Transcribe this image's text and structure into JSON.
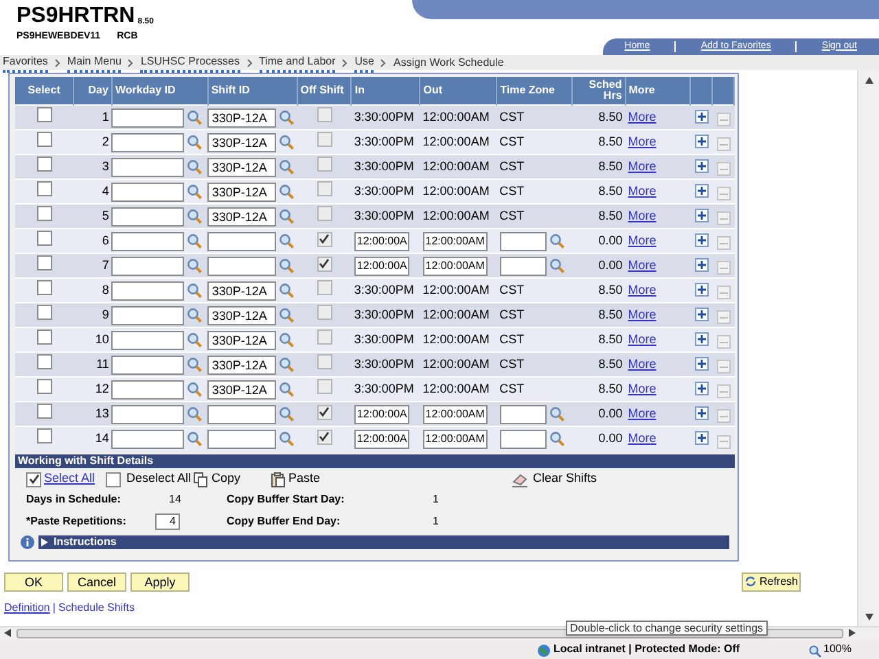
{
  "header": {
    "app": "PS9HRTRN",
    "version": "8.50",
    "database": "PS9HEWEBDEV11",
    "user": "RCB",
    "links": [
      "Home",
      "Add to Favorites",
      "Sign out"
    ]
  },
  "breadcrumbs": [
    {
      "label": "Favorites",
      "menu": true
    },
    {
      "label": "Main Menu",
      "menu": true
    },
    {
      "label": "LSUHSC Processes",
      "menu": true
    },
    {
      "label": "Time and Labor",
      "menu": true
    },
    {
      "label": "Use",
      "menu": true
    },
    {
      "label": "Assign Work Schedule",
      "menu": false
    }
  ],
  "table": {
    "columns": [
      "Select",
      "Day",
      "Workday ID",
      "Shift ID",
      "Off Shift",
      "In",
      "Out",
      "Time Zone",
      "Sched Hrs",
      "More"
    ],
    "rows": [
      {
        "day": "1",
        "kind": "shift",
        "selected": false,
        "shift_id": "330P-12A",
        "off_shift": false,
        "in": "3:30:00PM",
        "out": "12:00:00AM",
        "time_zone": "CST",
        "hrs": "8.50",
        "more": "More"
      },
      {
        "day": "2",
        "kind": "shift",
        "selected": false,
        "shift_id": "330P-12A",
        "off_shift": false,
        "in": "3:30:00PM",
        "out": "12:00:00AM",
        "time_zone": "CST",
        "hrs": "8.50",
        "more": "More"
      },
      {
        "day": "3",
        "kind": "shift",
        "selected": false,
        "shift_id": "330P-12A",
        "off_shift": false,
        "in": "3:30:00PM",
        "out": "12:00:00AM",
        "time_zone": "CST",
        "hrs": "8.50",
        "more": "More"
      },
      {
        "day": "4",
        "kind": "shift",
        "selected": false,
        "shift_id": "330P-12A",
        "off_shift": false,
        "in": "3:30:00PM",
        "out": "12:00:00AM",
        "time_zone": "CST",
        "hrs": "8.50",
        "more": "More"
      },
      {
        "day": "5",
        "kind": "shift",
        "selected": false,
        "shift_id": "330P-12A",
        "off_shift": false,
        "in": "3:30:00PM",
        "out": "12:00:00AM",
        "time_zone": "CST",
        "hrs": "8.50",
        "more": "More"
      },
      {
        "day": "6",
        "kind": "off",
        "selected": false,
        "off_shift": true,
        "in": "12:00:00A",
        "out": "12:00:00AM",
        "hrs": "0.00",
        "more": "More"
      },
      {
        "day": "7",
        "kind": "off",
        "selected": false,
        "off_shift": true,
        "in": "12:00:00A",
        "out": "12:00:00AM",
        "hrs": "0.00",
        "more": "More"
      },
      {
        "day": "8",
        "kind": "shift",
        "selected": false,
        "shift_id": "330P-12A",
        "off_shift": false,
        "in": "3:30:00PM",
        "out": "12:00:00AM",
        "time_zone": "CST",
        "hrs": "8.50",
        "more": "More"
      },
      {
        "day": "9",
        "kind": "shift",
        "selected": false,
        "shift_id": "330P-12A",
        "off_shift": false,
        "in": "3:30:00PM",
        "out": "12:00:00AM",
        "time_zone": "CST",
        "hrs": "8.50",
        "more": "More"
      },
      {
        "day": "10",
        "kind": "shift",
        "selected": false,
        "shift_id": "330P-12A",
        "off_shift": false,
        "in": "3:30:00PM",
        "out": "12:00:00AM",
        "time_zone": "CST",
        "hrs": "8.50",
        "more": "More"
      },
      {
        "day": "11",
        "kind": "shift",
        "selected": false,
        "shift_id": "330P-12A",
        "off_shift": false,
        "in": "3:30:00PM",
        "out": "12:00:00AM",
        "time_zone": "CST",
        "hrs": "8.50",
        "more": "More"
      },
      {
        "day": "12",
        "kind": "shift",
        "selected": false,
        "shift_id": "330P-12A",
        "off_shift": false,
        "in": "3:30:00PM",
        "out": "12:00:00AM",
        "time_zone": "CST",
        "hrs": "8.50",
        "more": "More"
      },
      {
        "day": "13",
        "kind": "off",
        "selected": false,
        "off_shift": true,
        "in": "12:00:00A",
        "out": "12:00:00AM",
        "hrs": "0.00",
        "more": "More"
      },
      {
        "day": "14",
        "kind": "off",
        "selected": false,
        "off_shift": true,
        "in": "12:00:00A",
        "out": "12:00:00AM",
        "hrs": "0.00",
        "more": "More"
      }
    ]
  },
  "shift_details": {
    "title": "Working with Shift Details",
    "select_all": {
      "label": "Select All",
      "checked": true
    },
    "deselect_all": {
      "label": "Deselect All",
      "checked": false
    },
    "copy": "Copy",
    "paste": "Paste",
    "clear": "Clear Shifts",
    "days_label": "Days in Schedule:",
    "days": "14",
    "start_label": "Copy Buffer Start Day:",
    "start": "1",
    "reps_label": "*Paste Repetitions:",
    "reps": "4",
    "end_label": "Copy Buffer End Day:",
    "end": "1",
    "instructions": {
      "label": "Instructions",
      "expanded": false
    }
  },
  "buttons": [
    "OK",
    "Cancel",
    "Apply"
  ],
  "refresh": "Refresh",
  "footer_links": [
    "Definition",
    "Schedule Shifts"
  ],
  "footer_separator": "|",
  "status_bar": {
    "zone": "Local intranet | Protected Mode: Off",
    "zoom": "100%",
    "tooltip": "Double-click to change security settings"
  }
}
